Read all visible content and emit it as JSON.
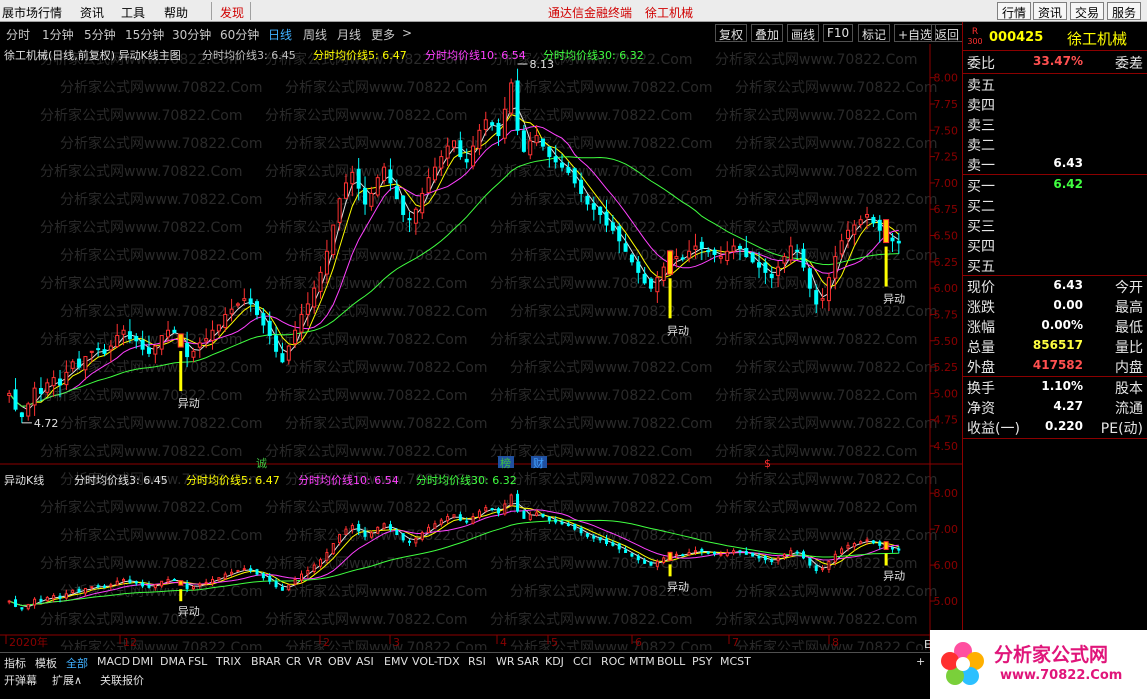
{
  "menubar": {
    "items": [
      "展市场行情",
      "资讯",
      "工具",
      "帮助"
    ],
    "discover": "发现",
    "terminal": "通达信金融终端",
    "stock": "徐工机械",
    "right_buttons": [
      "行情",
      "资讯",
      "交易",
      "服务"
    ]
  },
  "periods": {
    "items": [
      "分时",
      "1分钟",
      "5分钟",
      "15分钟",
      "30分钟",
      "60分钟",
      "日线",
      "周线",
      "月线",
      "更多"
    ],
    "active": "日线",
    "more_arrow": ">",
    "tools": [
      "复权",
      "叠加",
      "画线",
      "F10",
      "标记",
      "+自选",
      "返回"
    ]
  },
  "main_chart": {
    "title": "徐工机械(日线,前复权) 异动K线主图",
    "indicators": [
      {
        "label": "分时均价线3: 6.45",
        "color": "#e0e0e0"
      },
      {
        "label": "分时均价线5: 6.47",
        "color": "#ffff00"
      },
      {
        "label": "分时均价线10: 6.54",
        "color": "#ff40ff"
      },
      {
        "label": "分时均价线30: 6.32",
        "color": "#40ff40"
      }
    ],
    "price_labels": [
      "8.00",
      "7.75",
      "7.50",
      "7.25",
      "7.00",
      "6.75",
      "6.50",
      "6.25",
      "6.00",
      "5.75",
      "5.50",
      "5.25",
      "5.00",
      "4.75",
      "4.50"
    ],
    "high_label": "8.13",
    "low_label": "4.72",
    "signal_label": "异动",
    "event_marks": [
      "诚",
      "榜",
      "财",
      "$"
    ]
  },
  "sub_chart": {
    "title": "异动K线",
    "indicators": [
      {
        "label": "分时均价线3: 6.45",
        "color": "#e0e0e0"
      },
      {
        "label": "分时均价线5: 6.47",
        "color": "#ffff00"
      },
      {
        "label": "分时均价线10: 6.54",
        "color": "#ff40ff"
      },
      {
        "label": "分时均价线30: 6.32",
        "color": "#40ff40"
      }
    ],
    "price_labels": [
      "8.00",
      "7.00",
      "6.00",
      "5.00"
    ],
    "signal_label": "异动"
  },
  "time_axis": {
    "labels": [
      "2020年",
      "12",
      "2",
      "3",
      "4",
      "5",
      "6",
      "7",
      "8"
    ],
    "end_mark": "E"
  },
  "watermark": "分析家公式网www.70822.Com",
  "quote_panel": {
    "code": "000425",
    "name": "徐工机械",
    "badge_top": "R",
    "badge_bottom": "300",
    "weibi": {
      "label": "委比",
      "value": "33.47%",
      "label2": "委差"
    },
    "sell": [
      {
        "label": "卖五",
        "value": ""
      },
      {
        "label": "卖四",
        "value": ""
      },
      {
        "label": "卖三",
        "value": ""
      },
      {
        "label": "卖二",
        "value": ""
      },
      {
        "label": "卖一",
        "value": "6.43"
      }
    ],
    "buy": [
      {
        "label": "买一",
        "value": "6.42"
      },
      {
        "label": "买二",
        "value": ""
      },
      {
        "label": "买三",
        "value": ""
      },
      {
        "label": "买四",
        "value": ""
      },
      {
        "label": "买五",
        "value": ""
      }
    ],
    "stats": [
      {
        "label": "现价",
        "value": "6.43",
        "label2": "今开",
        "color": "#ffffff"
      },
      {
        "label": "涨跌",
        "value": "0.00",
        "label2": "最高",
        "color": "#ffffff"
      },
      {
        "label": "涨幅",
        "value": "0.00%",
        "label2": "最低",
        "color": "#ffffff"
      },
      {
        "label": "总量",
        "value": "856517",
        "label2": "量比",
        "color": "#ffff40"
      },
      {
        "label": "外盘",
        "value": "417582",
        "label2": "内盘",
        "color": "#ff5050"
      },
      {
        "label": "换手",
        "value": "1.10%",
        "label2": "股本",
        "color": "#ffffff"
      },
      {
        "label": "净资",
        "value": "4.27",
        "label2": "流通",
        "color": "#ffffff"
      },
      {
        "label": "收益(一)",
        "value": "0.220",
        "label2": "PE(动)",
        "color": "#ffffff"
      }
    ]
  },
  "bottom": {
    "tabs_row1": [
      "指标",
      "模板",
      "全部",
      "MACD",
      "DMI",
      "DMA",
      "FSL",
      "TRIX",
      "BRAR",
      "CR",
      "VR",
      "OBV",
      "ASI",
      "EMV",
      "VOL-TDX",
      "RSI",
      "WR",
      "SAR",
      "KDJ",
      "CCI",
      "ROC",
      "MTM",
      "BOLL",
      "PSY",
      "MCST"
    ],
    "active_tab": "全部",
    "plus": "+",
    "tabs_row2": [
      "开弹幕",
      "扩展∧",
      "关联报价"
    ]
  },
  "logo": {
    "text": "分析家公式网",
    "url_text": "www.70822.Com"
  },
  "colors": {
    "up": "#ff3232",
    "down": "#00ffff",
    "grid_border": "#8b0000",
    "signal": "#ffff00"
  },
  "chart_data": {
    "type": "candlestick",
    "title": "徐工机械(日线,前复权) 异动K线主图",
    "ylim": [
      4.5,
      8.13
    ],
    "x_months": [
      "2020年",
      "12",
      "1",
      "2",
      "3",
      "4",
      "5",
      "6",
      "7",
      "8"
    ],
    "closes": [
      5.0,
      4.85,
      4.78,
      4.9,
      5.05,
      5.0,
      5.1,
      5.15,
      5.08,
      5.2,
      5.3,
      5.25,
      5.35,
      5.4,
      5.42,
      5.38,
      5.45,
      5.55,
      5.6,
      5.52,
      5.5,
      5.42,
      5.38,
      5.45,
      5.55,
      5.6,
      5.58,
      5.5,
      5.35,
      5.4,
      5.48,
      5.52,
      5.6,
      5.65,
      5.75,
      5.8,
      5.85,
      5.9,
      5.85,
      5.75,
      5.65,
      5.55,
      5.4,
      5.3,
      5.45,
      5.6,
      5.75,
      5.85,
      6.0,
      6.15,
      6.35,
      6.6,
      6.85,
      7.0,
      7.1,
      6.95,
      6.8,
      6.9,
      7.05,
      7.15,
      7.0,
      6.85,
      6.7,
      6.65,
      6.75,
      6.9,
      7.05,
      7.15,
      7.25,
      7.35,
      7.4,
      7.25,
      7.2,
      7.35,
      7.5,
      7.6,
      7.55,
      7.45,
      7.7,
      7.95,
      7.5,
      7.3,
      7.4,
      7.45,
      7.35,
      7.25,
      7.2,
      7.15,
      7.1,
      7.0,
      6.9,
      6.8,
      6.75,
      6.7,
      6.6,
      6.55,
      6.45,
      6.35,
      6.25,
      6.15,
      6.05,
      6.0,
      6.1,
      6.2,
      6.25,
      6.3,
      6.28,
      6.35,
      6.4,
      6.38,
      6.35,
      6.32,
      6.3,
      6.35,
      6.4,
      6.38,
      6.3,
      6.25,
      6.2,
      6.15,
      6.1,
      6.2,
      6.3,
      6.4,
      6.35,
      6.2,
      6.0,
      5.85,
      5.9,
      6.1,
      6.3,
      6.45,
      6.55,
      6.6,
      6.65,
      6.7,
      6.62,
      6.55,
      6.5,
      6.45,
      6.43
    ],
    "signals_at_index": [
      27,
      104,
      138
    ],
    "signal_label": "异动",
    "annotations": [
      {
        "label": "8.13",
        "type": "high"
      },
      {
        "label": "4.72",
        "type": "low"
      }
    ],
    "series": [
      {
        "name": "分时均价线3",
        "last": 6.45
      },
      {
        "name": "分时均价线5",
        "last": 6.47
      },
      {
        "name": "分时均价线10",
        "last": 6.54
      },
      {
        "name": "分时均价线30",
        "last": 6.32
      }
    ]
  }
}
